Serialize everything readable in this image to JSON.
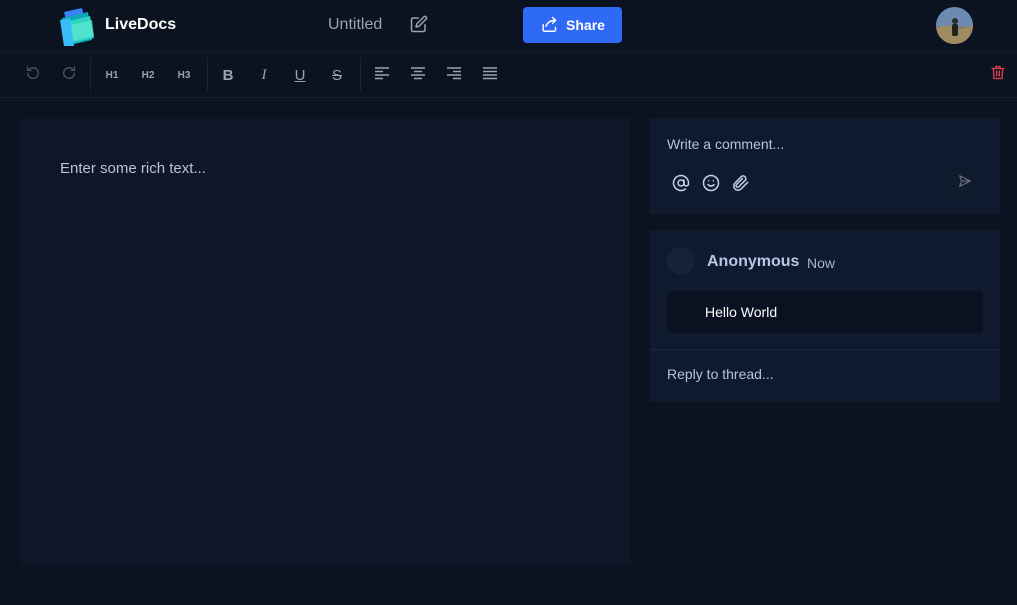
{
  "header": {
    "app_name": "LiveDocs",
    "doc_title": "Untitled",
    "share_label": "Share"
  },
  "toolbar": {
    "h1": "H1",
    "h2": "H2",
    "h3": "H3",
    "bold": "B",
    "italic": "I",
    "underline": "U",
    "strike": "S"
  },
  "editor": {
    "placeholder": "Enter some rich text..."
  },
  "comments": {
    "composer_placeholder": "Write a comment...",
    "thread": {
      "author": "Anonymous",
      "time": "Now",
      "text": "Hello World",
      "reply_placeholder": "Reply to thread..."
    }
  },
  "colors": {
    "background": "#0b1220",
    "accent": "#2e6af6",
    "danger": "#e0434b"
  },
  "icons": [
    "logo-icon",
    "edit-icon",
    "share-icon",
    "undo-icon",
    "redo-icon",
    "align-left-icon",
    "align-center-icon",
    "align-right-icon",
    "align-justify-icon",
    "trash-icon",
    "mention-icon",
    "emoji-icon",
    "attach-icon",
    "send-icon"
  ]
}
